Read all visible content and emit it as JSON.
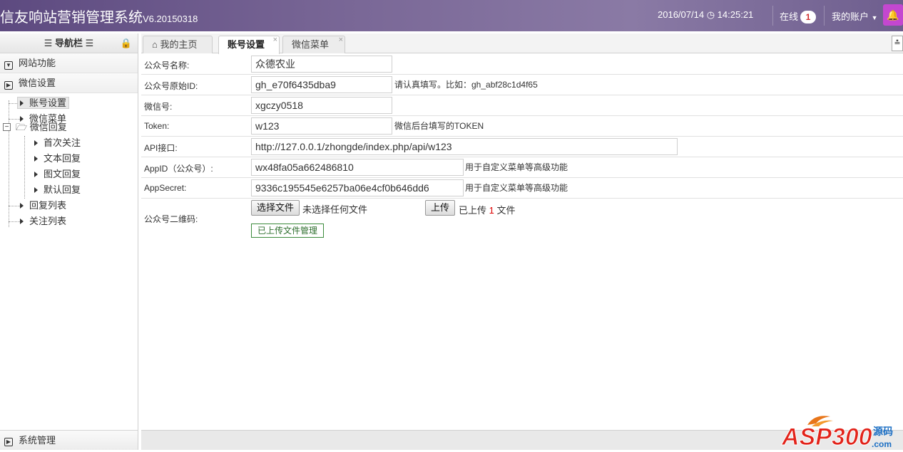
{
  "header": {
    "title": "信友响站营销管理系统",
    "version": "V6.20150318",
    "date": "2016/07/14",
    "time": "14:25:21",
    "online_label": "在线",
    "online_count": "1",
    "account_label": "我的账户"
  },
  "sidebar": {
    "title": "导航栏",
    "groups": [
      {
        "label": "网站功能"
      },
      {
        "label": "微信设置"
      }
    ],
    "tree": {
      "account_settings": "账号设置",
      "wechat_menu": "微信菜单",
      "wechat_reply": "微信回复",
      "first_follow": "首次关注",
      "text_reply": "文本回复",
      "image_text_reply": "图文回复",
      "default_reply": "默认回复",
      "reply_list": "回复列表",
      "follow_list": "关注列表"
    },
    "bottom_group": "系统管理"
  },
  "tabs": [
    {
      "label": "我的主页"
    },
    {
      "label": "账号设置"
    },
    {
      "label": "微信菜单"
    }
  ],
  "form": {
    "name": {
      "label": "公众号名称:",
      "value": "众德农业"
    },
    "original_id": {
      "label": "公众号原始ID:",
      "value": "gh_e70f6435dba9",
      "hint": "请认真填写。比如：gh_abf28c1d4f65"
    },
    "wechat_no": {
      "label": "微信号:",
      "value": "xgczy0518"
    },
    "token": {
      "label": "Token:",
      "value": "w123",
      "hint": "微信后台填写的TOKEN"
    },
    "api": {
      "label": "API接口:",
      "value": "http://127.0.0.1/zhongde/index.php/api/w123"
    },
    "appid": {
      "label": "AppID（公众号）:",
      "value": "wx48fa05a662486810",
      "hint": "用于自定义菜单等高级功能"
    },
    "appsecret": {
      "label": "AppSecret:",
      "value": "9336c195545e6257ba06e4cf0b646dd6",
      "hint": "用于自定义菜单等高级功能"
    },
    "qrcode": {
      "label": "公众号二维码:",
      "choose_file": "选择文件",
      "no_file": "未选择任何文件",
      "upload": "上传",
      "uploaded_prefix": "已上传",
      "uploaded_count": "1",
      "uploaded_suffix": "文件",
      "manage": "已上传文件管理"
    }
  },
  "watermark": {
    "text": "ASP300",
    "sub": "源码",
    "domain": ".com"
  },
  "colors": {
    "header": "#6e5e8e",
    "bell": "#c447d0",
    "manage_border": "#3b8a3b",
    "badge_text": "#d12f2f"
  }
}
